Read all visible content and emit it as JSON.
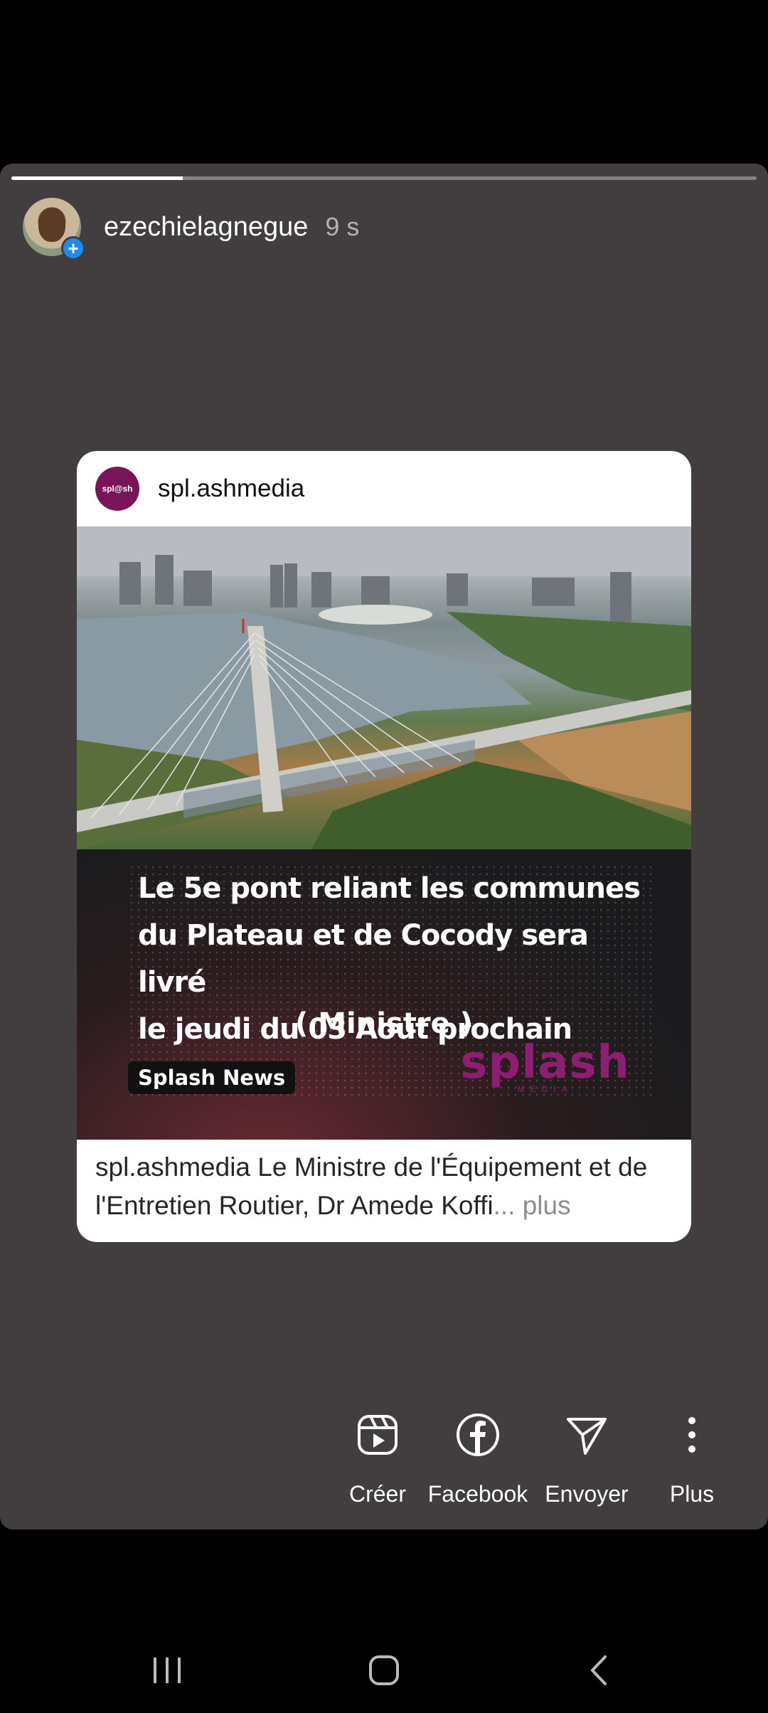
{
  "story": {
    "progress": 0.23,
    "username": "ezechielagnegue",
    "time": "9 s"
  },
  "card": {
    "avatar_text": "spl@sh",
    "username": "spl.ashmedia",
    "headline_lines": [
      "Le 5e pont reliant les communes",
      "du Plateau et de Cocody sera  livré",
      "le jeudi du 03 Aout prochain"
    ],
    "headline_sub": "( Ministre )",
    "tag": "Splash News",
    "logo_text": "splash",
    "logo_sub": "MEDIA",
    "caption_user": "spl.ashmedia",
    "caption_text": " Le Ministre de l'Équipement et de l'Entretien Routier, Dr Amede Koffi",
    "caption_more": "... plus"
  },
  "actions": [
    {
      "label": "Créer",
      "icon": "reels-icon"
    },
    {
      "label": "Facebook",
      "icon": "facebook-icon"
    },
    {
      "label": "Envoyer",
      "icon": "send-icon"
    },
    {
      "label": "Plus",
      "icon": "more-vertical-icon"
    }
  ],
  "navbar": [
    "recent-apps-icon",
    "home-icon",
    "back-icon"
  ],
  "colors": {
    "story_bg": "#423e40",
    "brand": "#8e1e74",
    "plus_badge": "#1d8cf0"
  }
}
